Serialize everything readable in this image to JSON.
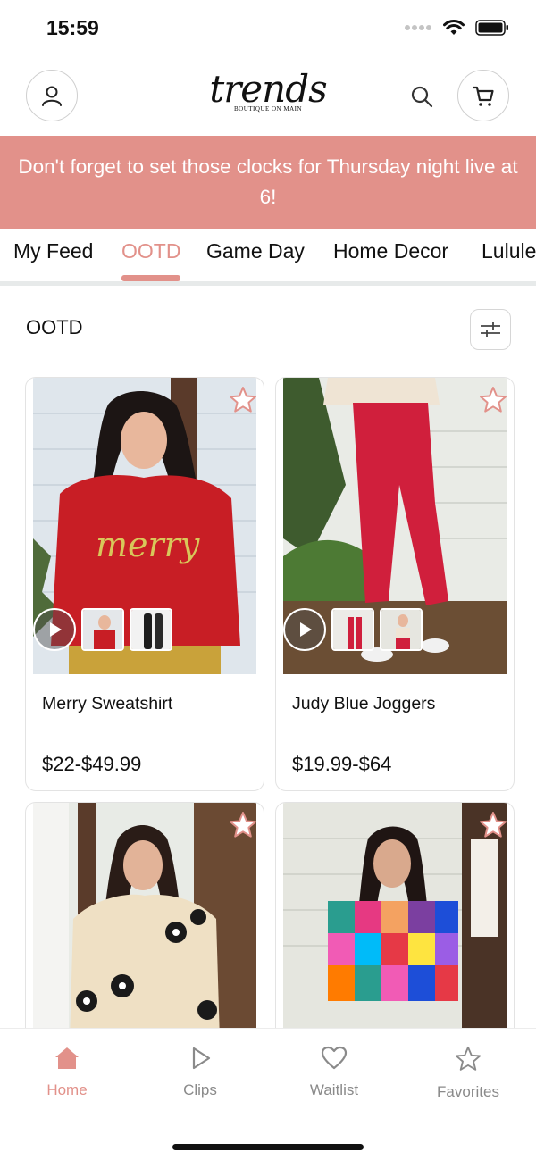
{
  "status": {
    "time": "15:59"
  },
  "header": {
    "logo_word": "trends",
    "logo_sub": "BOUTIQUE ON MAIN"
  },
  "banner": {
    "text": "Don't forget to set those clocks for Thursday night live at 6!"
  },
  "tabs": [
    {
      "label": "My Feed"
    },
    {
      "label": "OOTD",
      "active": true
    },
    {
      "label": "Game Day"
    },
    {
      "label": "Home Decor"
    },
    {
      "label": "Lululemon"
    }
  ],
  "section": {
    "title": "OOTD"
  },
  "products": [
    {
      "name": "Merry Sweatshirt",
      "price": "$22-$49.99"
    },
    {
      "name": "Judy Blue Joggers",
      "price": "$19.99-$64"
    },
    {
      "name": "",
      "price": ""
    },
    {
      "name": "",
      "price": ""
    }
  ],
  "tabbar": [
    {
      "label": "Home",
      "icon": "home-icon",
      "active": true
    },
    {
      "label": "Clips",
      "icon": "play-icon"
    },
    {
      "label": "Waitlist",
      "icon": "heart-icon"
    },
    {
      "label": "Favorites",
      "icon": "star-icon"
    }
  ],
  "colors": {
    "accent": "#e2918a",
    "divider": "#e7eaea",
    "muted": "#8a8a8a"
  }
}
